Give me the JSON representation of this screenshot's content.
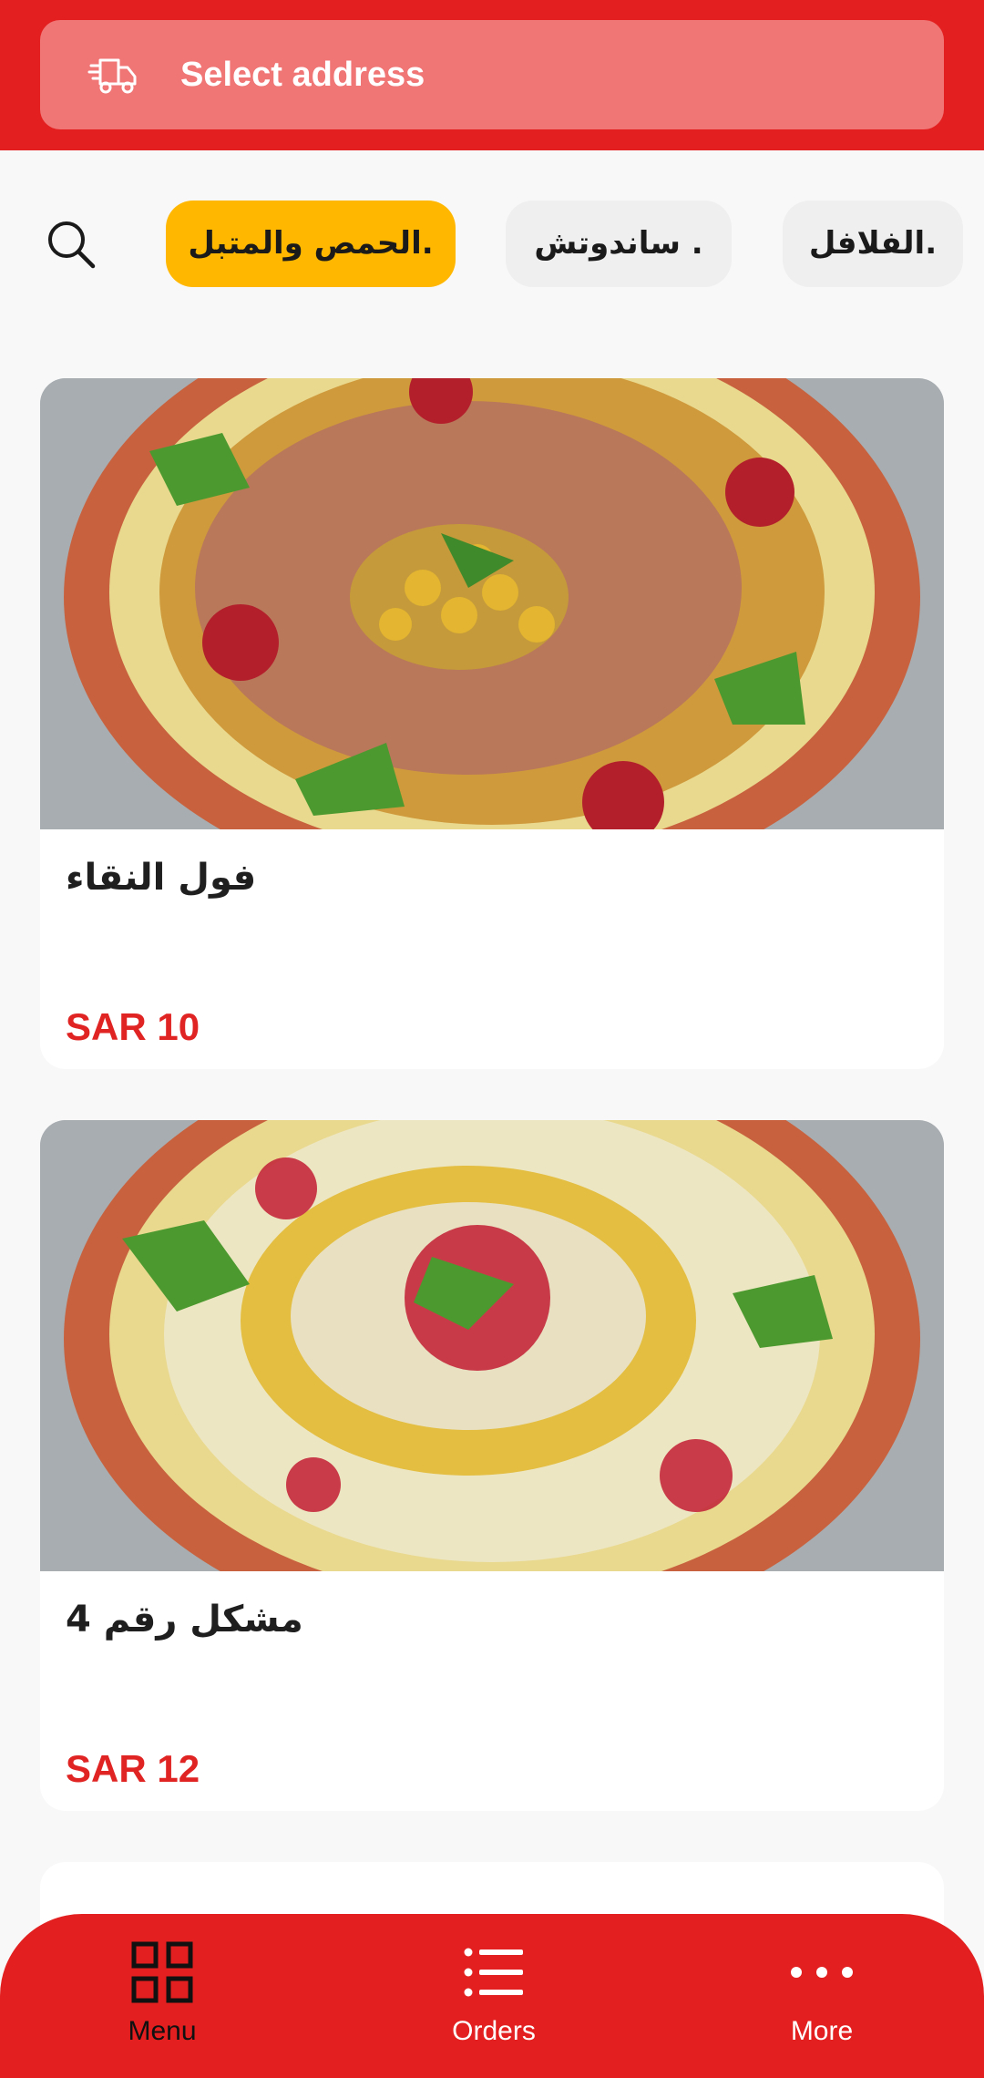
{
  "header": {
    "address_label": "Select address",
    "icon": "delivery-truck-icon"
  },
  "categories": {
    "search_icon": "search-icon",
    "items": [
      {
        "label": "الحمص والمتبل.",
        "active": true
      },
      {
        "label": "ساندوتش .",
        "active": false
      },
      {
        "label": "الفلافل.",
        "active": false
      }
    ]
  },
  "products": [
    {
      "name": "فول النقاء",
      "price": "SAR 10"
    },
    {
      "name": "مشكل رقم  4",
      "price": "SAR 12"
    }
  ],
  "bottom_nav": {
    "items": [
      {
        "label": "Menu",
        "icon": "grid-icon",
        "active": true
      },
      {
        "label": "Orders",
        "icon": "list-icon",
        "active": false
      },
      {
        "label": "More",
        "icon": "more-dots-icon",
        "active": false
      }
    ]
  },
  "colors": {
    "brand_red": "#e31f1f",
    "address_bar": "#f07575",
    "active_chip": "#ffb700",
    "price": "#e02424"
  }
}
